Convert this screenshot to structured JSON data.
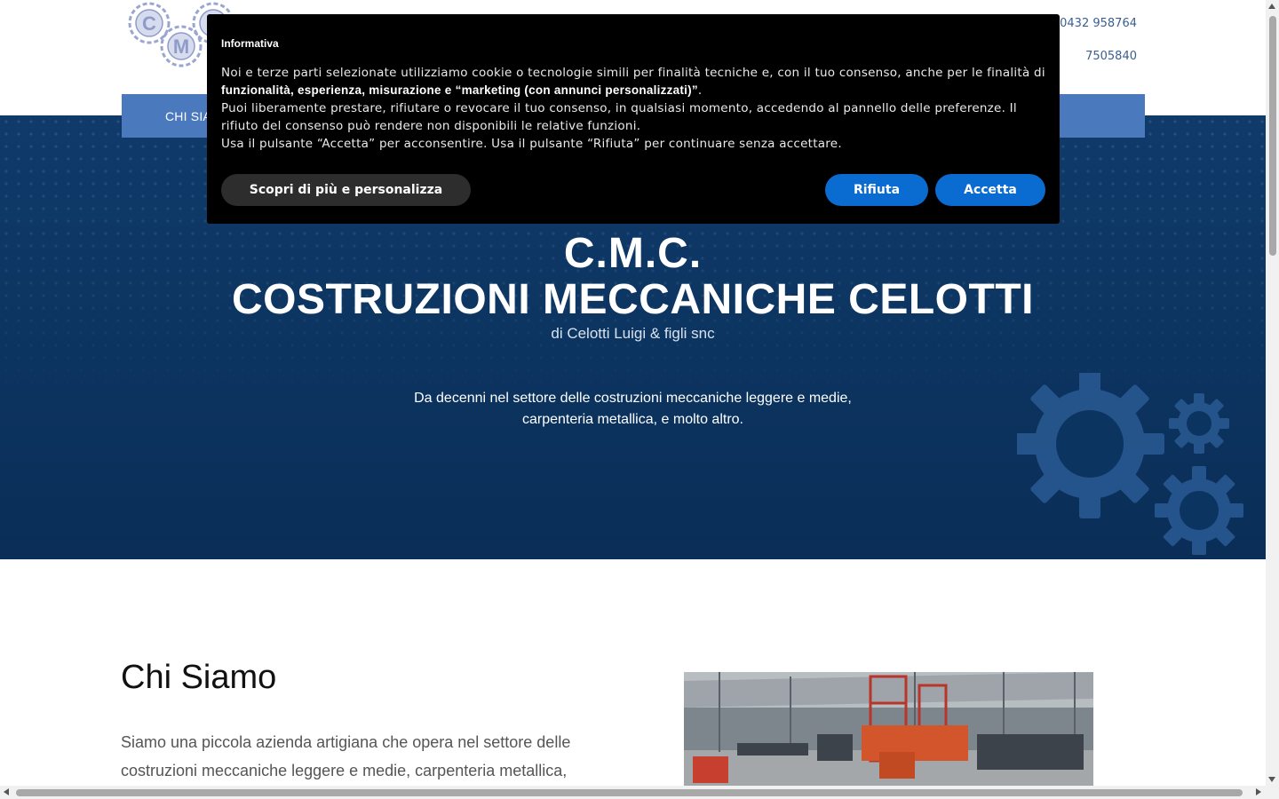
{
  "header": {
    "logo_text": "CMC",
    "phone_landline": "telefono fisso:0432 958764",
    "phone_mobile": "7505840"
  },
  "nav": {
    "items": [
      {
        "label": "CHI SIA"
      }
    ]
  },
  "hero": {
    "title_line1": "C.M.C.",
    "title_line2": "COSTRUZIONI MECCANICHE CELOTTI",
    "subtitle": "di Celotti Luigi & figli snc",
    "desc_line1": "Da decenni nel settore delle costruzioni meccaniche leggere e medie,",
    "desc_line2": "carpenteria metallica, e molto altro."
  },
  "about": {
    "title": "Chi Siamo",
    "text": "Siamo una piccola azienda artigiana che opera nel settore delle costruzioni meccaniche leggere e medie, carpenteria metallica,"
  },
  "cookie": {
    "title": "Informativa",
    "p1_pre": "Noi e terze parti selezionate utilizziamo cookie o tecnologie simili per finalità tecniche e, con il tuo consenso, anche per le finalità di ",
    "p1_bold": "funzionalità, esperienza, misurazione e “marketing (con annunci personalizzati)”",
    "p1_post": ".",
    "p2": "Puoi liberamente prestare, rifiutare o revocare il tuo consenso, in qualsiasi momento, accedendo al pannello delle preferenze. Il rifiuto del consenso può rendere non disponibili le relative funzioni.",
    "p3": "Usa il pulsante “Accetta” per acconsentire. Usa il pulsante “Rifiuta” per continuare senza accettare.",
    "btn_more": "Scopri di più e personalizza",
    "btn_reject": "Rifiuta",
    "btn_accept": "Accetta"
  },
  "colors": {
    "nav": "#4a79be",
    "hero": "#0c3460",
    "cookie_bg": "#000000",
    "button_primary": "#0a6bd0"
  }
}
